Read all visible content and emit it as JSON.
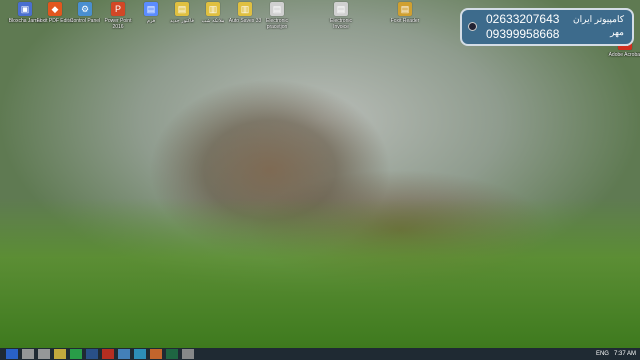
{
  "banner": {
    "phone1": "02633207643",
    "phone2": "09399958668",
    "brand": "کامپیوتر ایران مهر"
  },
  "icons": [
    {
      "label": "Bloxcha Jamal",
      "glyph": "▣",
      "color": "#4a6fd0"
    },
    {
      "label": "Foxit PDF Editor",
      "glyph": "◆",
      "color": "#e2571e"
    },
    {
      "label": "Control Panel",
      "glyph": "⚙",
      "color": "#4a8fd0"
    },
    {
      "label": "Power Point 2016",
      "glyph": "P",
      "color": "#d24726"
    },
    {
      "label": "فرم",
      "glyph": "▤",
      "color": "#5b8cff"
    },
    {
      "label": "فاکتور جدید",
      "glyph": "▤",
      "color": "#e0c040"
    },
    {
      "label": "ملائکه شب",
      "glyph": "▥",
      "color": "#e0c040"
    },
    {
      "label": "Auto Saves 33",
      "glyph": "▥",
      "color": "#e0c040"
    },
    {
      "label": "Electronic pracetjon",
      "glyph": "▤",
      "color": "#d0d0d0"
    },
    {
      "label": "Electronic Invoice",
      "glyph": "▤",
      "color": "#d0d0d0"
    },
    {
      "label": "Foxit Reader",
      "glyph": "▤",
      "color": "#d0a030"
    },
    {
      "label": "Adobe Acrobat",
      "glyph": "A",
      "color": "#d12f1f"
    }
  ],
  "taskbar": {
    "apps": [
      "start",
      "search",
      "task-view",
      "explorer",
      "chrome",
      "word",
      "pdf",
      "mail",
      "vpn",
      "media",
      "excel",
      "settings"
    ],
    "tray": {
      "lang": "ENG",
      "time": "7:37 AM"
    }
  }
}
